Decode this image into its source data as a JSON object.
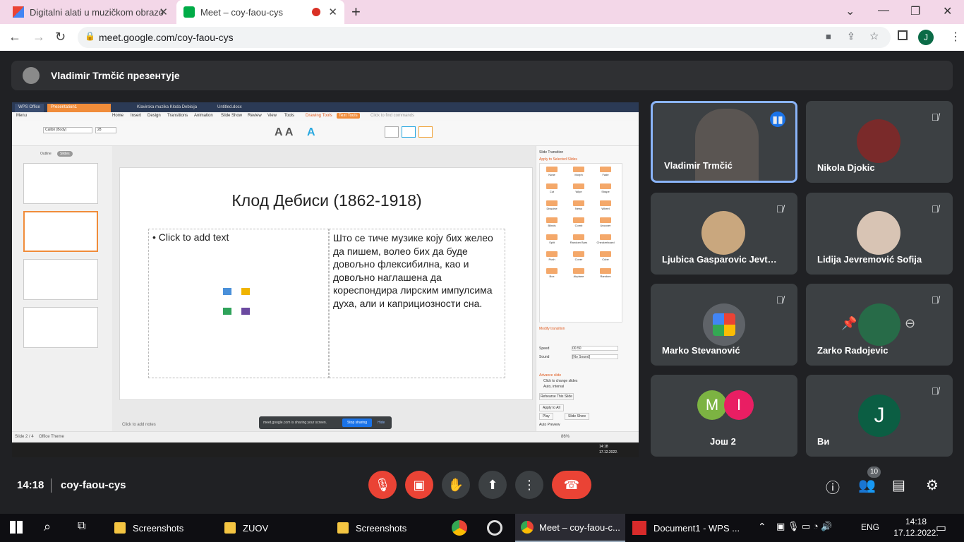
{
  "browser": {
    "tabs": [
      {
        "title": "Digitalni alati u muzičkom obrazo",
        "active": false
      },
      {
        "title": "Meet – coy-faou-cys",
        "active": true
      }
    ],
    "new_tab": "+",
    "url": "meet.google.com/coy-faou-cys",
    "profile_initial": "J",
    "min_icon": "—",
    "restore_icon": "❐",
    "close_icon": "✕"
  },
  "presenter": {
    "label": "Vladimir Trmčić презентује"
  },
  "shared_screen": {
    "app_tabs": [
      "WPS Office",
      "Presentation1",
      "Klavirska muzika Kloda Debisija",
      "Untitled.docx"
    ],
    "menu_items": [
      "Menu",
      "Home",
      "Insert",
      "Design",
      "Transitions",
      "Animation",
      "Slide Show",
      "Review",
      "View",
      "Tools",
      "Drawing Tools",
      "Text Tools"
    ],
    "find_commands": "Click to find commands",
    "font_name": "Calibri (Body)",
    "font_size": "28",
    "panel_tabs": [
      "Outline",
      "Slides"
    ],
    "slide_title": "Клод Дебиси (1862-1918)",
    "left_placeholder": "• Click to add text",
    "right_text": "Што се тиче музике коју бих желео да пишем, волео бих да буде довољно флексибилна, као и довољно наглашена да кореспондира лирским импулсима духа, али и каприциозности сна.",
    "notes": "Click to add notes",
    "status_left": "Slide 2 / 4",
    "status_theme": "Office Theme",
    "zoom": "86%",
    "transition_panel": {
      "title": "Slide Transition",
      "apply": "Apply to Selected Slides",
      "effects": [
        "None",
        "Morph",
        "Fade",
        "Cut",
        "Wipe",
        "Shape",
        "Dissolve",
        "News",
        "Wheel",
        "Blinds",
        "Comb",
        "Uncover",
        "Split",
        "Random Bars",
        "Checkerboard",
        "Push",
        "Cover",
        "Cube",
        "Box",
        "Airplane",
        "Random"
      ],
      "modify": "Modify transition",
      "speed_label": "Speed",
      "speed_value": "00.50",
      "sound_label": "Sound",
      "sound_value": "[No Sound]",
      "advance": "Advance slide",
      "on_click": "Click to change slides",
      "auto": "Auto, interval",
      "apply_all": "Apply to All",
      "play": "Play",
      "slideshow": "Slide Show",
      "autopreview": "Auto Preview",
      "rehearse": "Rehearse This Slide"
    },
    "share_notice": "meet.google.com is sharing your screen.",
    "stop_sharing": "Stop sharing",
    "hide": "Hide",
    "clock": "14:18",
    "date": "17.12.2022."
  },
  "participants": [
    {
      "name": "Vladimir Trmčić",
      "speaking": true
    },
    {
      "name": "Nikola Djokic",
      "muted": true
    },
    {
      "name": "Ljubica Gasparovic Jevt…",
      "muted": true
    },
    {
      "name": "Lidija Jevremović Sofija",
      "muted": true
    },
    {
      "name": "Marko Stevanović",
      "muted": true
    },
    {
      "name": "Zarko Radojevic",
      "muted": true
    },
    {
      "name": "Још 2",
      "initials": [
        "M",
        "I"
      ]
    },
    {
      "name": "Ви",
      "initial": "J",
      "muted": true
    }
  ],
  "meeting": {
    "time": "14:18",
    "code": "coy-faou-cys",
    "people_count": "10"
  },
  "colors": {
    "meet_bg": "#202124",
    "tile_bg": "#3c4043",
    "red": "#ea4335",
    "accent_blue": "#8ab4f8",
    "tab_strip": "#f3d7e8"
  },
  "taskbar": {
    "items": [
      "Screenshots",
      "ZUOV",
      "Screenshots",
      "Meet – coy-faou-c...",
      "Document1 - WPS ..."
    ],
    "lang": "ENG",
    "time": "14:18",
    "date": "17.12.2022."
  }
}
